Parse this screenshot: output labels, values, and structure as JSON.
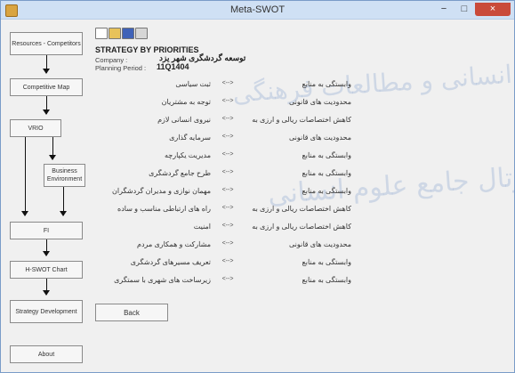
{
  "window": {
    "title": "Meta-SWOT",
    "min_symbol": "−",
    "max_symbol": "□",
    "close_symbol": "×"
  },
  "sidebar": {
    "items": [
      {
        "label": "Resources - Competitors"
      },
      {
        "label": "Competitive Map"
      },
      {
        "label": "VRIO"
      },
      {
        "label": "Business Environment"
      },
      {
        "label": "FI"
      },
      {
        "label": "H-SWOT Chart"
      },
      {
        "label": "Strategy Development"
      },
      {
        "label": "About"
      }
    ]
  },
  "toolbar": {
    "icons": [
      "new-icon",
      "open-icon",
      "save-icon",
      "print-icon"
    ]
  },
  "main": {
    "heading": "STRATEGY BY PRIORITIES",
    "company_label": "Company :",
    "company_value": "توسعه گردشگری شهر یزد",
    "period_label": "Planning Period :",
    "period_value": "11Q1404",
    "arrow": "<-->",
    "rows": [
      {
        "left": "ثبت سیاسی",
        "right": "وابستگی به منابع"
      },
      {
        "left": "توجه به مشتریان",
        "right": "محدودیت های قانونی"
      },
      {
        "left": "نیروی انسانی لازم",
        "right": "کاهش اختصاصات ریالی و ارزی به"
      },
      {
        "left": "سرمایه گذاری",
        "right": "محدودیت های قانونی"
      },
      {
        "left": "مدیریت یکپارچه",
        "right": "وابستگی به منابع"
      },
      {
        "left": "طرح جامع گردشگری",
        "right": "وابستگی به منابع"
      },
      {
        "left": "مهمان نوازی و مدیران گردشگران",
        "right": "وابستگی به منابع"
      },
      {
        "left": "راه های ارتباطی مناسب و ساده",
        "right": "کاهش اختصاصات ریالی و ارزی به"
      },
      {
        "left": "امنیت",
        "right": "کاهش اختصاصات ریالی و ارزی به"
      },
      {
        "left": "مشارکت و همکاری مردم",
        "right": "محدودیت های قانونی"
      },
      {
        "left": "تعریف مسیرهای گردشگری",
        "right": "وابستگی به منابع"
      },
      {
        "left": "زیرساخت های شهری با سمتگری",
        "right": "وابستگی به منابع"
      }
    ],
    "back_label": "Back"
  },
  "watermark": {
    "line1": "پژوهشگاه علوم انسانی و مطالعات فرهنگی",
    "line2": "پرتال جامع علوم انسانی"
  },
  "colors": {
    "titlebar": "#cfe0f4",
    "close_button": "#c94a3a",
    "watermark": "#7896c8"
  }
}
